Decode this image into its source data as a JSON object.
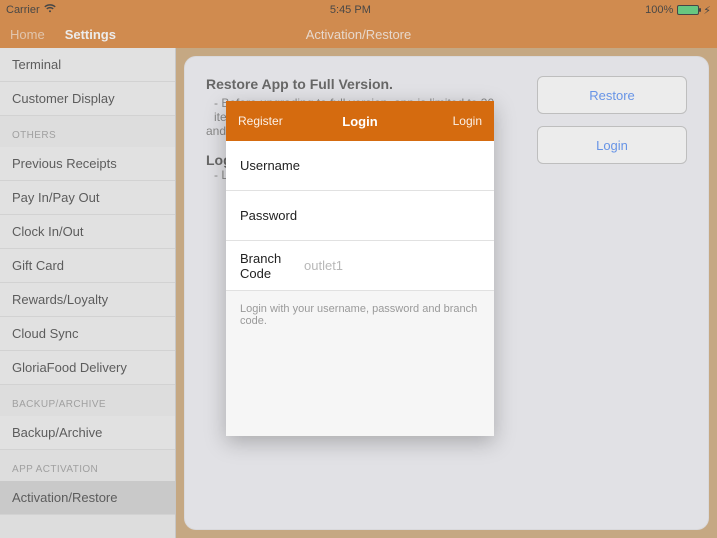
{
  "status": {
    "carrier": "Carrier",
    "time": "5:45 PM",
    "battery_pct": "100%"
  },
  "topbar": {
    "home": "Home",
    "settings": "Settings",
    "title": "Activation/Restore"
  },
  "sidebar": {
    "items_top": [
      "Terminal",
      "Customer Display"
    ],
    "header_others": "OTHERS",
    "items_others": [
      "Previous Receipts",
      "Pay In/Pay Out",
      "Clock In/Out",
      "Gift Card",
      "Rewards/Loyalty",
      "Cloud Sync",
      "GloriaFood Delivery"
    ],
    "header_backup": "BACKUP/ARCHIVE",
    "items_backup": [
      "Backup/Archive"
    ],
    "header_app": "APP ACTIVATION",
    "items_app": [
      "Activation/Restore"
    ]
  },
  "panel": {
    "restore_title": "Restore App to Full Version.",
    "restore_line1": "- Before upgrading to full version, app is limited to 30 items",
    "restore_line2": "and 2",
    "login_head": "Log",
    "login_line": "- Lo",
    "btn_restore": "Restore",
    "btn_login": "Login"
  },
  "modal": {
    "register": "Register",
    "title": "Login",
    "login": "Login",
    "username_label": "Username",
    "username_value": "",
    "password_label": "Password",
    "password_value": "",
    "branch_label": "Branch Code",
    "branch_placeholder": "outlet1",
    "branch_value": "",
    "hint": "Login with your username, password and branch code."
  }
}
